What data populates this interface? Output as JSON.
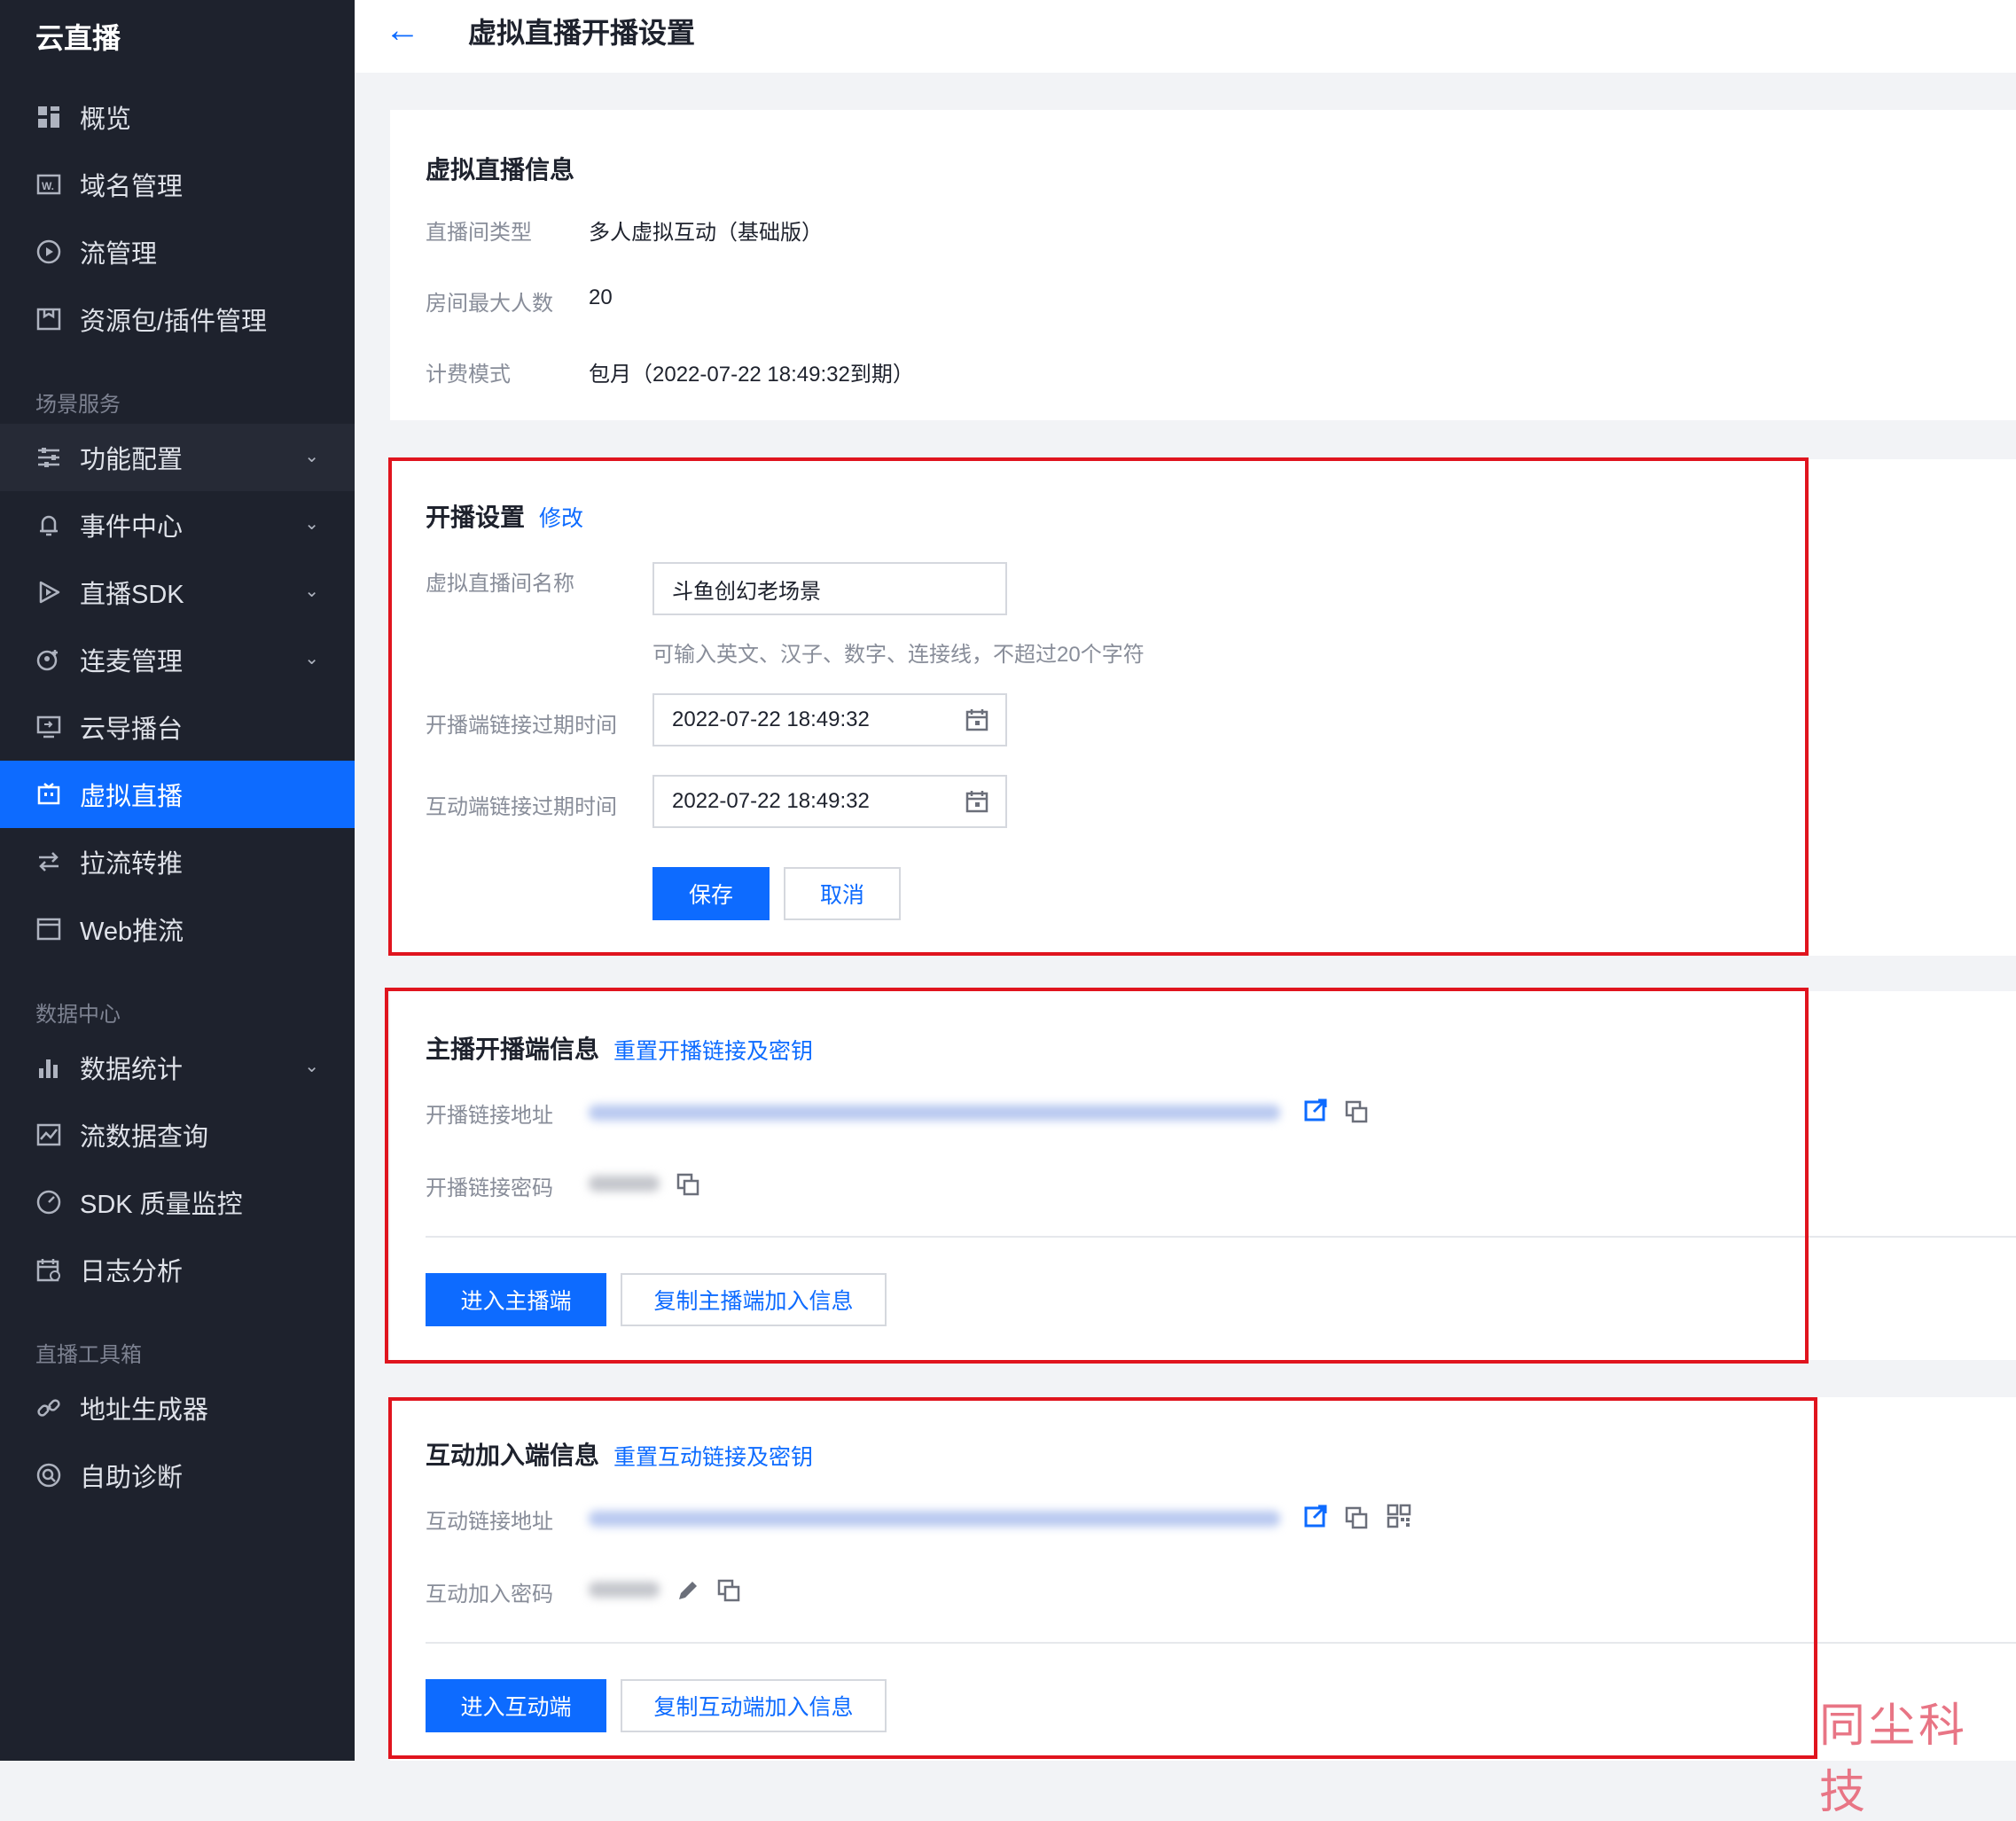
{
  "sidebar": {
    "brand": "云直播",
    "top_items": [
      {
        "label": "概览",
        "icon": "dashboard-icon"
      },
      {
        "label": "域名管理",
        "icon": "domain-icon"
      },
      {
        "label": "流管理",
        "icon": "stream-icon"
      },
      {
        "label": "资源包/插件管理",
        "icon": "package-icon"
      }
    ],
    "group_scene": "场景服务",
    "scene_items": [
      {
        "label": "功能配置",
        "icon": "settings-sliders-icon",
        "expandable": true
      },
      {
        "label": "事件中心",
        "icon": "bell-icon",
        "expandable": true
      },
      {
        "label": "直播SDK",
        "icon": "play-icon",
        "expandable": true
      },
      {
        "label": "连麦管理",
        "icon": "mic-link-icon",
        "expandable": true
      },
      {
        "label": "云导播台",
        "icon": "monitor-icon"
      },
      {
        "label": "虚拟直播",
        "icon": "virtual-live-icon",
        "active": true
      },
      {
        "label": "拉流转推",
        "icon": "transfer-icon"
      },
      {
        "label": "Web推流",
        "icon": "web-icon"
      }
    ],
    "group_data": "数据中心",
    "data_items": [
      {
        "label": "数据统计",
        "icon": "bar-chart-icon",
        "expandable": true
      },
      {
        "label": "流数据查询",
        "icon": "line-chart-icon"
      },
      {
        "label": "SDK 质量监控",
        "icon": "gauge-icon"
      },
      {
        "label": "日志分析",
        "icon": "calendar-log-icon"
      }
    ],
    "group_tools": "直播工具箱",
    "tool_items": [
      {
        "label": "地址生成器",
        "icon": "link-icon"
      },
      {
        "label": "自助诊断",
        "icon": "diagnose-icon"
      }
    ]
  },
  "header": {
    "title": "虚拟直播开播设置"
  },
  "info": {
    "title": "虚拟直播信息",
    "rows": [
      {
        "label": "直播间类型",
        "value": "多人虚拟互动（基础版）"
      },
      {
        "label": "房间最大人数",
        "value": "20"
      },
      {
        "label": "计费模式",
        "value": "包月（2022-07-22 18:49:32到期）"
      }
    ]
  },
  "broadcast": {
    "title": "开播设置",
    "edit_link": "修改",
    "name_label": "虚拟直播间名称",
    "name_value": "斗鱼创幻老场景",
    "name_hint": "可输入英文、汉子、数字、连接线，不超过20个字符",
    "host_expire_label": "开播端链接过期时间",
    "host_expire_value": "2022-07-22 18:49:32",
    "interact_expire_label": "互动端链接过期时间",
    "interact_expire_value": "2022-07-22 18:49:32",
    "save": "保存",
    "cancel": "取消"
  },
  "host": {
    "title": "主播开播端信息",
    "reset_link": "重置开播链接及密钥",
    "url_label": "开播链接地址",
    "pwd_label": "开播链接密码",
    "enter": "进入主播端",
    "copy": "复制主播端加入信息"
  },
  "interact": {
    "title": "互动加入端信息",
    "reset_link": "重置互动链接及密钥",
    "url_label": "互动链接地址",
    "pwd_label": "互动加入密码",
    "enter": "进入互动端",
    "copy": "复制互动端加入信息"
  },
  "watermark": "同尘科技",
  "colors": {
    "accent": "#0d6bff",
    "sidebar": "#1e222d",
    "highlight_box": "#e0141e"
  }
}
